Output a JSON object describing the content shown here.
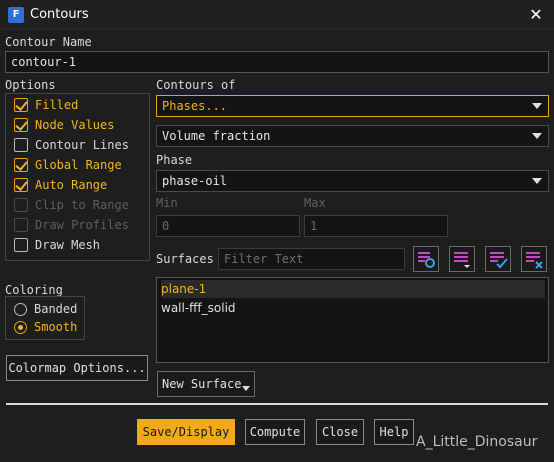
{
  "window": {
    "title": "Contours",
    "app_icon_letter": "F"
  },
  "contour_name": {
    "label": "Contour Name",
    "value": "contour-1"
  },
  "options": {
    "label": "Options",
    "items": [
      {
        "label": "Filled",
        "checked": true,
        "enabled": true
      },
      {
        "label": "Node Values",
        "checked": true,
        "enabled": true
      },
      {
        "label": "Contour Lines",
        "checked": false,
        "enabled": true
      },
      {
        "label": "Global Range",
        "checked": true,
        "enabled": true
      },
      {
        "label": "Auto Range",
        "checked": true,
        "enabled": true
      },
      {
        "label": "Clip to Range",
        "checked": false,
        "enabled": false
      },
      {
        "label": "Draw Profiles",
        "checked": false,
        "enabled": false
      },
      {
        "label": "Draw Mesh",
        "checked": false,
        "enabled": true
      }
    ]
  },
  "coloring": {
    "label": "Coloring",
    "options": [
      {
        "label": "Banded",
        "selected": false
      },
      {
        "label": "Smooth",
        "selected": true
      }
    ]
  },
  "colormap_button": "Colormap Options...",
  "contours_of": {
    "label": "Contours of",
    "primary_value": "Phases...",
    "secondary_value": "Volume fraction"
  },
  "phase": {
    "label": "Phase",
    "value": "phase-oil"
  },
  "range": {
    "min_label": "Min",
    "min_value": "0",
    "max_label": "Max",
    "max_value": "1"
  },
  "surfaces": {
    "label": "Surfaces",
    "filter_placeholder": "Filter Text",
    "icons": [
      "select-by-type-icon",
      "list-menu-icon",
      "select-all-icon",
      "deselect-all-icon"
    ],
    "items": [
      {
        "label": "plane-1",
        "selected": true
      },
      {
        "label": "wall-fff_solid",
        "selected": false
      }
    ],
    "new_surface": "New Surface"
  },
  "footer": {
    "save_display": "Save/Display",
    "compute": "Compute",
    "close": "Close",
    "help": "Help"
  },
  "watermark": "A_Little_Dinosaur",
  "colors": {
    "accent": "#f0b429",
    "background": "#1e1e1e"
  }
}
